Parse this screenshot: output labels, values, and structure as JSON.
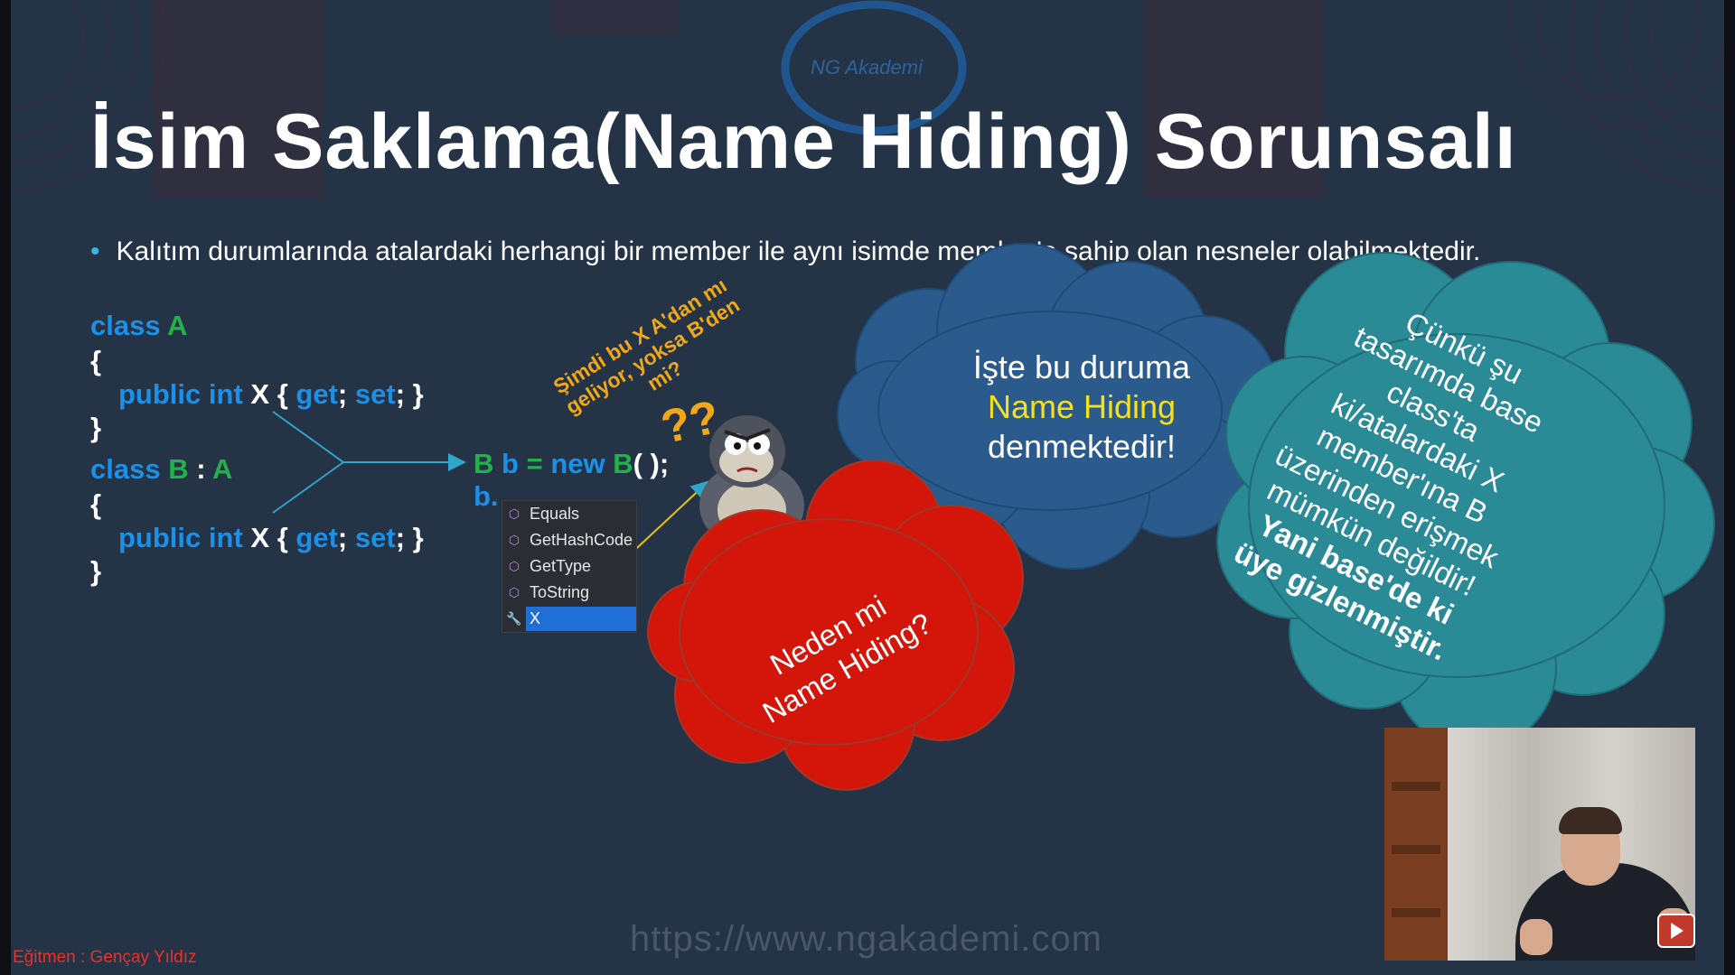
{
  "slide": {
    "logo": "NG Akademi",
    "title": "İsim Saklama(Name Hiding) Sorunsalı",
    "bullet": "Kalıtım durumlarında atalardaki herhangi bir member ile aynı isimde member'a sahip olan nesneler olabilmektedir.",
    "code_a": {
      "kw_class": "class",
      "name": "A",
      "open": "{",
      "kw_public": "public",
      "kw_int": "int",
      "member": "X",
      "brace_l": "{",
      "get": "get",
      "semi1": ";",
      "set": "set",
      "semi2": ";",
      "brace_r": "}",
      "close": "}"
    },
    "code_b": {
      "kw_class": "class",
      "name": "B",
      "colon": ":",
      "base": "A",
      "open": "{",
      "kw_public": "public",
      "kw_int": "int",
      "member": "X",
      "brace_l": "{",
      "get": "get",
      "semi1": ";",
      "set": "set",
      "semi2": ";",
      "brace_r": "}",
      "close": "}"
    },
    "instantiation": {
      "type": "B",
      "var": "b",
      "eq": "=",
      "kw_new": "new",
      "ctor": "B",
      "parens": "( );",
      "access": "b."
    },
    "completion_items": [
      {
        "label": "Equals",
        "icon": "method-icon"
      },
      {
        "label": "GetHashCode",
        "icon": "method-icon"
      },
      {
        "label": "GetType",
        "icon": "method-icon"
      },
      {
        "label": "ToString",
        "icon": "method-icon"
      },
      {
        "label": "X",
        "icon": "wrench-icon"
      }
    ],
    "question_text": [
      "Şimdi bu X A'dan mı",
      "geliyor, yoksa B'den",
      "mi?"
    ],
    "red_cloud": [
      "Neden mi",
      "Name Hiding?"
    ],
    "blue_cloud": {
      "line1": "İşte bu duruma",
      "highlight": "Name Hiding",
      "line3": "denmektedir!"
    },
    "teal_cloud": {
      "lines": [
        "Çünkü şu",
        "tasarımda base",
        "class'ta",
        "ki/atalardaki X",
        "member'ına B",
        "üzerinden erişmek",
        "mümkün değildir!"
      ],
      "bold_lines": [
        "Yani base'de ki",
        "üye gizlenmiştir."
      ]
    },
    "footer_instructor": "Eğitmen : Gençay Yıldız",
    "url_watermark": "https://www.ngakademi.com"
  },
  "colors": {
    "background": "#243346",
    "keyword": "#1c8fe6",
    "type": "#22b14c",
    "red_cloud": "#d4160a",
    "blue_cloud": "#2a5b8c",
    "teal_cloud": "#2a8a96",
    "highlight": "#f5e11b",
    "question": "#f0a818"
  }
}
